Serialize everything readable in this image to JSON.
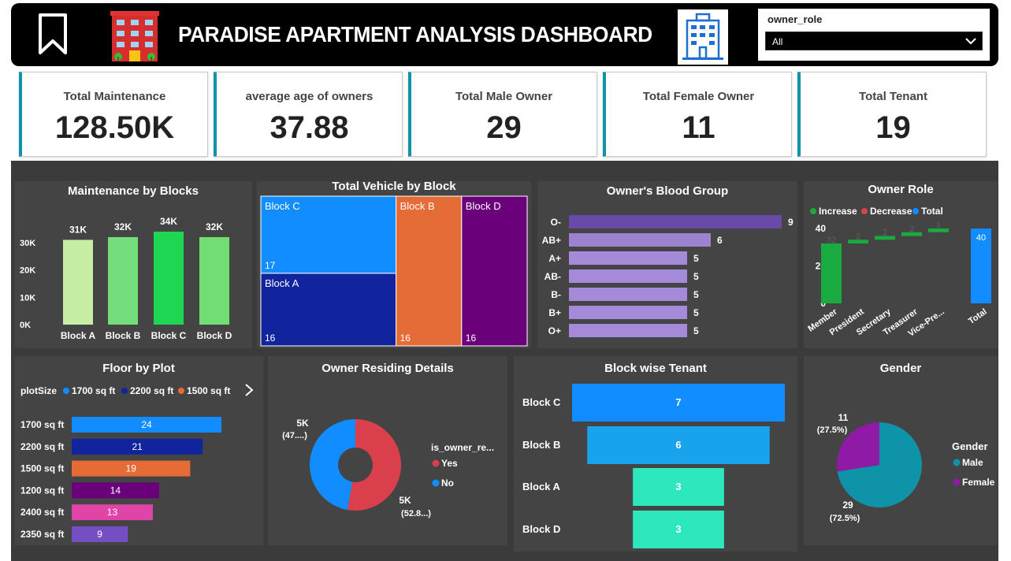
{
  "header": {
    "title": "PARADISE APARTMENT ANALYSIS DASHBOARD",
    "slicer_label": "owner_role",
    "slicer_value": "All"
  },
  "kpis": [
    {
      "label": "Total Maintenance",
      "value": "128.50K"
    },
    {
      "label": "average age of owners",
      "value": "37.88"
    },
    {
      "label": "Total Male Owner",
      "value": "29"
    },
    {
      "label": "Total Female Owner",
      "value": "11"
    },
    {
      "label": "Total Tenant",
      "value": "19"
    }
  ],
  "colors": {
    "kpi_accent": "#0e93a8",
    "panel_bg": "#444444",
    "dash_bg": "#3b3b3b"
  },
  "chart_data": [
    {
      "id": "maintenance",
      "type": "bar",
      "title": "Maintenance by Blocks",
      "categories": [
        "Block A",
        "Block B",
        "Block C",
        "Block D"
      ],
      "values": [
        31,
        32,
        34,
        32
      ],
      "value_labels": [
        "31K",
        "32K",
        "34K",
        "32K"
      ],
      "yticks": [
        "0K",
        "10K",
        "20K",
        "30K"
      ],
      "ylim": [
        0,
        34
      ],
      "colors": [
        "#c6eea4",
        "#74dd7c",
        "#1ed652",
        "#72dd72"
      ]
    },
    {
      "id": "vehicle",
      "type": "treemap",
      "title": "Total Vehicle by Block",
      "items": [
        {
          "name": "Block C",
          "value": 17,
          "color": "#118dff"
        },
        {
          "name": "Block A",
          "value": 16,
          "color": "#12239e"
        },
        {
          "name": "Block B",
          "value": 16,
          "color": "#e66c37"
        },
        {
          "name": "Block D",
          "value": 16,
          "color": "#6b007b"
        }
      ]
    },
    {
      "id": "blood",
      "type": "bar",
      "orientation": "horizontal",
      "title": "Owner's Blood Group",
      "categories": [
        "O-",
        "AB+",
        "A+",
        "AB-",
        "B-",
        "B+",
        "O+"
      ],
      "values": [
        9,
        6,
        5,
        5,
        5,
        5,
        5
      ],
      "colors": [
        "#6a4aa8",
        "#9d82cf",
        "#a48ad8",
        "#a48ad8",
        "#a48ad8",
        "#a48ad8",
        "#a48ad8"
      ]
    },
    {
      "id": "role",
      "type": "waterfall",
      "title": "Owner Role",
      "legend": [
        {
          "name": "Increase",
          "color": "#1aab40"
        },
        {
          "name": "Decrease",
          "color": "#d64550"
        },
        {
          "name": "Total",
          "color": "#118dff"
        }
      ],
      "categories": [
        "Member",
        "President",
        "Secretary",
        "Treasurer",
        "Vice-Pre...",
        "Total"
      ],
      "values": [
        32,
        2,
        2,
        2,
        2,
        40
      ],
      "value_labels": [
        "32",
        "2",
        "2",
        "2",
        "1",
        "40"
      ],
      "yticks": [
        "0",
        "20",
        "40"
      ],
      "ylim": [
        0,
        40
      ]
    },
    {
      "id": "floor",
      "type": "bar",
      "orientation": "horizontal",
      "title": "Floor by Plot",
      "legend_title": "plotSize",
      "legend": [
        {
          "name": "1700 sq ft",
          "color": "#118dff"
        },
        {
          "name": "2200 sq ft",
          "color": "#12239e"
        },
        {
          "name": "1500 sq ft",
          "color": "#e66c37"
        }
      ],
      "categories": [
        "1700 sq ft",
        "2200 sq ft",
        "1500 sq ft",
        "1200 sq ft",
        "2400 sq ft",
        "2350 sq ft"
      ],
      "values": [
        24,
        21,
        19,
        14,
        13,
        9
      ],
      "colors": [
        "#118dff",
        "#12239e",
        "#e66c37",
        "#6b007b",
        "#e044a7",
        "#744ec2"
      ]
    },
    {
      "id": "residing",
      "type": "pie",
      "donut": true,
      "title": "Owner Residing Details",
      "legend_title": "is_owner_re...",
      "slices": [
        {
          "name": "Yes",
          "value": 52.8,
          "color": "#d9404c"
        },
        {
          "name": "No",
          "value": 47.2,
          "color": "#118dff"
        }
      ],
      "labels": [
        {
          "line1": "5K",
          "line2": "(47....)"
        },
        {
          "line1": "5K",
          "line2": "(52.8...)"
        }
      ]
    },
    {
      "id": "tenant",
      "type": "funnel",
      "title": "Block wise Tenant",
      "categories": [
        "Block C",
        "Block B",
        "Block A",
        "Block D"
      ],
      "values": [
        7,
        6,
        3,
        3
      ],
      "colors": [
        "#118dff",
        "#19a3ec",
        "#2ee8bd",
        "#2ee8bd"
      ]
    },
    {
      "id": "gender",
      "type": "pie",
      "title": "Gender",
      "legend_title": "Gender",
      "slices": [
        {
          "name": "Male",
          "value": 29,
          "pct": "72.5%",
          "color": "#0e93a8"
        },
        {
          "name": "Female",
          "value": 11,
          "pct": "27.5%",
          "color": "#8f1aa5"
        }
      ],
      "labels": [
        {
          "line1": "29",
          "line2": "(72.5%)"
        },
        {
          "line1": "11",
          "line2": "(27.5%)"
        }
      ]
    }
  ]
}
